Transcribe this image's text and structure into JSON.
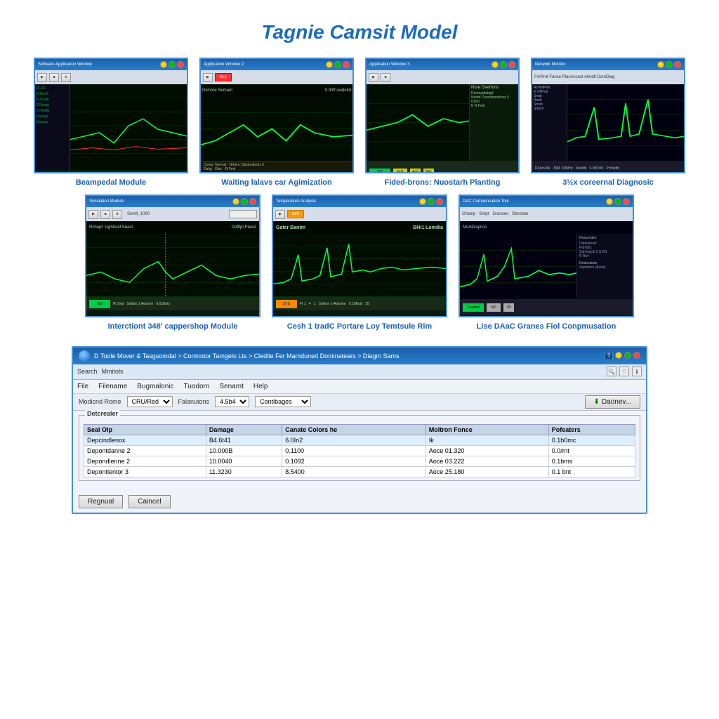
{
  "page": {
    "title": "Tagnie Camsit Model"
  },
  "row1": [
    {
      "label": "Beampedal Module",
      "id": "screenshot-1"
    },
    {
      "label": "Waiting lalavs car Agimization",
      "id": "screenshot-2"
    },
    {
      "label": "Fided-brons: Nuostarh Planting",
      "id": "screenshot-3"
    },
    {
      "label": "3½x coreernal Diagnosic",
      "id": "screenshot-4"
    }
  ],
  "row2": [
    {
      "label": "Interctiont 348' cappershop Module",
      "id": "screenshot-5"
    },
    {
      "label": "Cesh 1 tradC Portare Loy Temtsule Rim",
      "id": "screenshot-6"
    },
    {
      "label": "Lise DAaC Granes Fiol Conpmusation",
      "id": "screenshot-7"
    }
  ],
  "dialog": {
    "title": "D Toole Mover & Tasgsomdal > Comnotor Tamgelo Lts > Cledite Fer Mamduned Dominatears > Diagm Sams",
    "menu_items": [
      "Search",
      "Mmitols"
    ],
    "toolbar_items": [
      "File",
      "Filename",
      "Bugmalonic",
      "Tuodorn",
      "Senamt",
      "Help"
    ],
    "model_field": {
      "label": "Modicnd Rome",
      "value": "CRU/Red"
    },
    "parameters_field": {
      "label": "Falanutons",
      "value": "4.5b4"
    },
    "configurations_field": {
      "label": "Contibages",
      "value": ""
    },
    "download_btn": "Daonev...",
    "group_title": "Detcrealer",
    "table_headers": [
      "Seal Olp",
      "Damage",
      "Canate Colors he",
      "Moltron Fonce",
      "Pofeaters"
    ],
    "table_rows": [
      [
        "Depcindlenox",
        "B4.6t41",
        "6.0In2",
        "Ik",
        "0.1b0mc"
      ],
      [
        "Depontdanne 2",
        "10.000B",
        "0.1100",
        "Aoce 01.320",
        "0.0/mt"
      ],
      [
        "Depondlenne 2",
        "10.0040",
        "0.1092",
        "Aoce 03.222",
        "0.1bms"
      ],
      [
        "Depontlentor 3",
        "11.3230",
        "8.5400",
        "Aoce 25.180",
        "0.1 bnt"
      ]
    ],
    "footer_btns": [
      "Regnual",
      "Caincel"
    ]
  }
}
